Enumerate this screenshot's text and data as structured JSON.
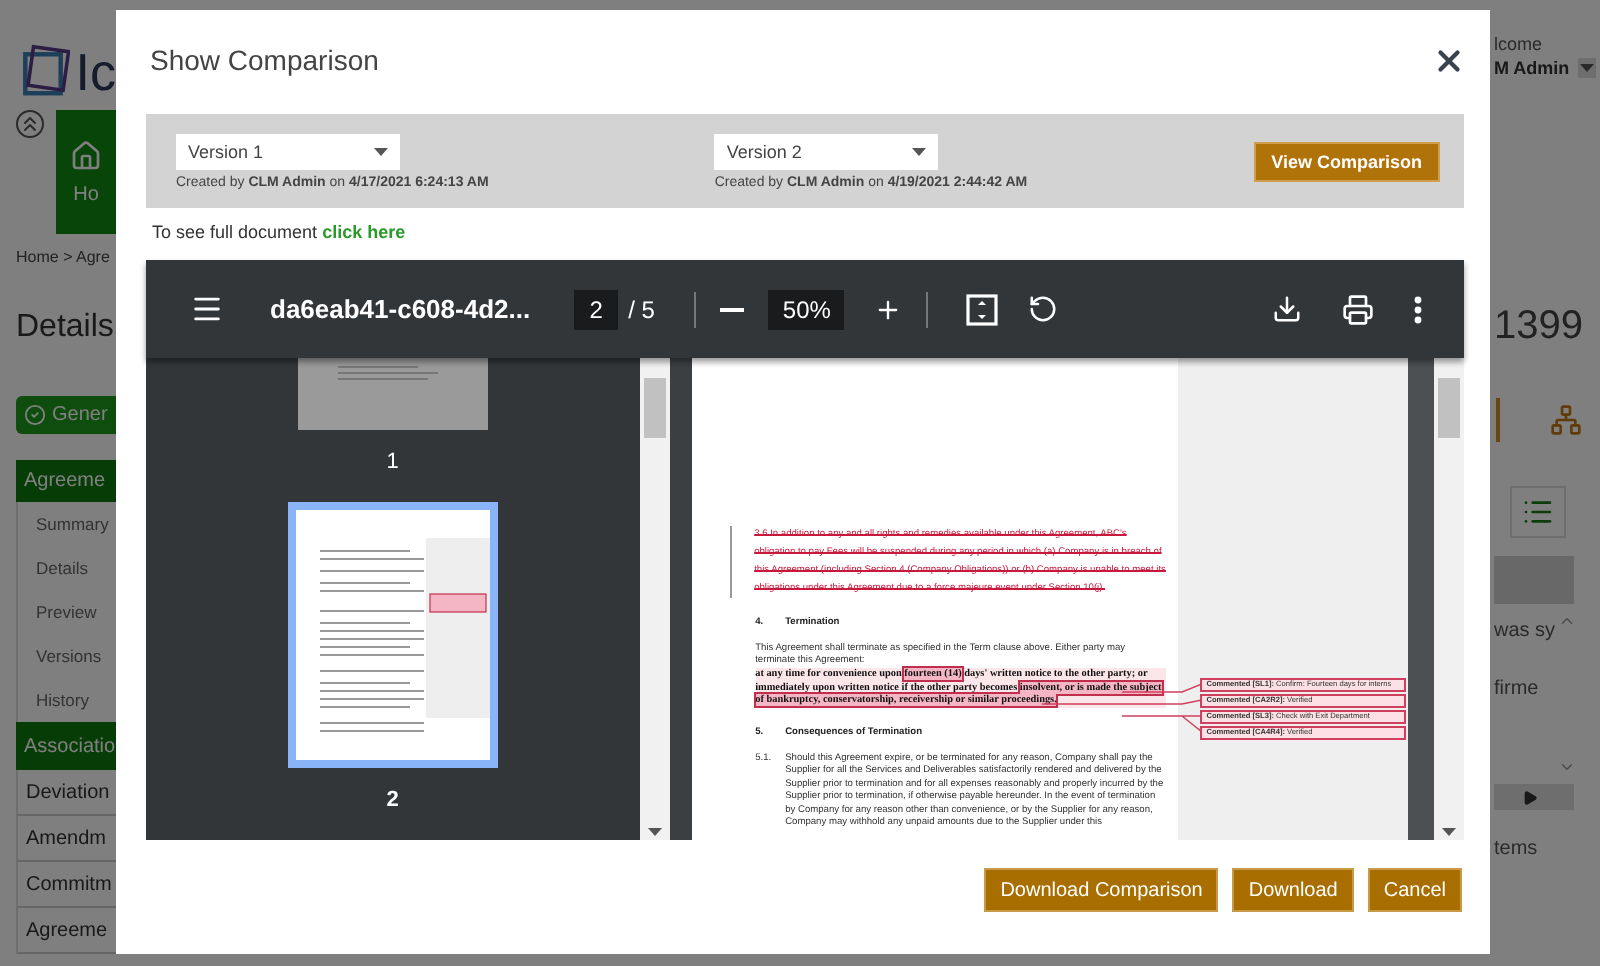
{
  "background": {
    "logo_text": "Ic",
    "home_tile": "Ho",
    "breadcrumb": "Home > Agre",
    "page_title": "Details",
    "general_button": "Gener",
    "nav": [
      {
        "kind": "header",
        "label": "Agreeme"
      },
      {
        "kind": "item",
        "label": "Summary"
      },
      {
        "kind": "item",
        "label": "Details"
      },
      {
        "kind": "item",
        "label": "Preview"
      },
      {
        "kind": "item",
        "label": "Versions"
      },
      {
        "kind": "item",
        "label": "History"
      },
      {
        "kind": "header",
        "label": "Associatio"
      },
      {
        "kind": "link",
        "label": "Deviation"
      },
      {
        "kind": "link",
        "label": "Amendm"
      },
      {
        "kind": "link",
        "label": "Commitm"
      },
      {
        "kind": "link",
        "label": "Agreeme"
      }
    ],
    "right_panel": {
      "welcome": "lcome",
      "user": "M Admin",
      "record_number": "1399",
      "rows": [
        "was sy",
        "firme"
      ],
      "footer_text": "tems"
    }
  },
  "dialog": {
    "title": "Show Comparison",
    "versions": [
      {
        "value": "Version 1",
        "created": "Created by **CLM Admin** on **4/17/2021 6:24:13 AM**"
      },
      {
        "value": "Version 2",
        "created": "Created by **CLM Admin** on **4/19/2021 2:44:42 AM**"
      }
    ],
    "view_button": "View Comparison",
    "full_document": {
      "text": "To see full document ",
      "link": "click here"
    },
    "viewer": {
      "filename": "da6eab41-c608-4d2...",
      "page": "2",
      "page_count": "/ 5",
      "zoom": "50%",
      "thumbnails": [
        {
          "label": "1",
          "selected": false
        },
        {
          "label": "2",
          "selected": true
        }
      ],
      "blocks": [
        {
          "kind": "deleted",
          "text": "3.6 In addition to any and all rights and remedies available under this Agreement, ABC's obligation to pay Fees will be suspended during any period in which (a) Company is in breach of this Agreement (including Section 4 (Company Obligations)) or (b) Company is unable to meet its obligations under this Agreement due to a force majeure event under Section 10(j)."
        },
        {
          "kind": "heading",
          "number": "4.",
          "text": "Termination"
        },
        {
          "kind": "paragraph",
          "text": "This Agreement shall terminate as specified in the Term clause above. Either party may terminate this Agreement:"
        },
        {
          "kind": "clause",
          "parts": [
            {
              "text": "at any time for convenience upon ",
              "highlighted": false
            },
            {
              "text": "fourteen (14)",
              "highlighted": true
            },
            {
              "text": " days' written notice to the other party; or immediately upon written notice if the other party becomes ",
              "highlighted": false
            },
            {
              "text": "insolvent, or is made the subject of bankruptcy, conservatorship, receivership or similar proceedings.",
              "highlighted": true
            }
          ]
        },
        {
          "kind": "heading",
          "number": "5.",
          "text": "Consequences of Termination"
        },
        {
          "kind": "numbered",
          "number": "5.1.",
          "text": "Should this Agreement expire, or be terminated for any reason, Company shall pay the Supplier for all the Services and Deliverables satisfactorily rendered and delivered by the Supplier prior to termination and for all expenses reasonably and properly incurred by the Supplier prior to termination, if otherwise payable hereunder. In the event of termination by Company for any reason other than convenience, or by the Supplier for any reason, Company may withhold any unpaid amounts due to the Supplier under this"
        }
      ],
      "comments": [
        "**Commented [SL1]:** Confirm: Fourteen days for interns",
        "**Commented [CA2R2]:** Verified",
        "**Commented [SL3]:** Check with Exit Department",
        "**Commented [CA4R4]:** Verified"
      ]
    },
    "buttons": [
      "Download Comparison",
      "Download",
      "Cancel"
    ]
  }
}
